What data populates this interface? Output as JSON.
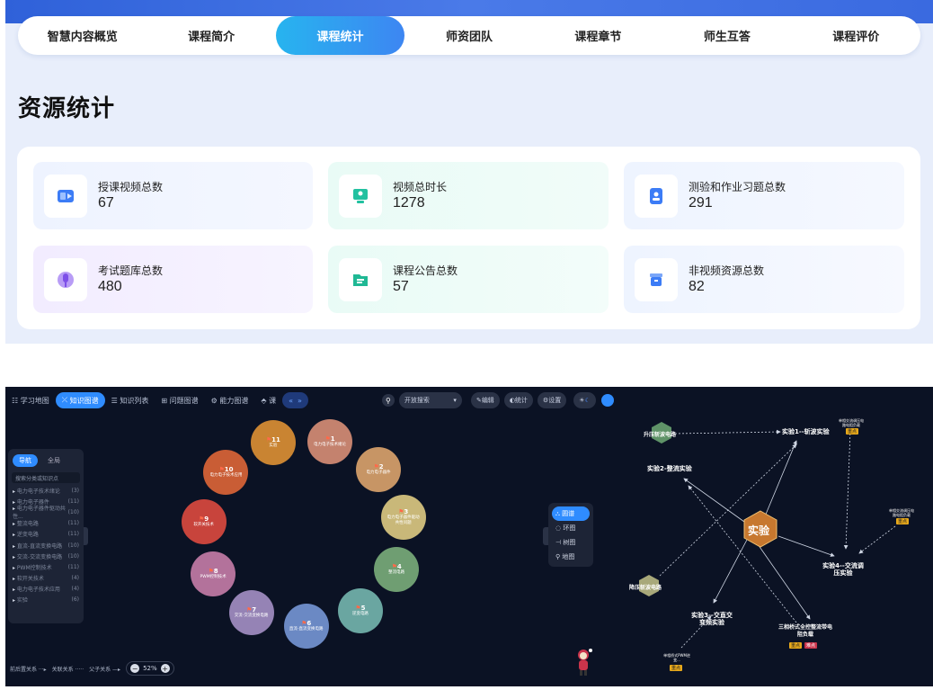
{
  "tabs": [
    "智慧内容概览",
    "课程简介",
    "课程统计",
    "师资团队",
    "课程章节",
    "师生互答",
    "课程评价"
  ],
  "active_tab": "课程统计",
  "section_title": "资源统计",
  "stats": [
    {
      "label": "授课视频总数",
      "value": "67",
      "icon": "video-icon",
      "color": "#3c7cf6"
    },
    {
      "label": "视频总时长",
      "value": "1278",
      "icon": "monitor-icon",
      "color": "#22c1a0"
    },
    {
      "label": "测验和作业习题总数",
      "value": "291",
      "icon": "quiz-icon",
      "color": "#3c7cf6"
    },
    {
      "label": "考试题库总数",
      "value": "480",
      "icon": "microphone-icon",
      "color": "#9b6cf0"
    },
    {
      "label": "课程公告总数",
      "value": "57",
      "icon": "folder-icon",
      "color": "#1fb894"
    },
    {
      "label": "非视频资源总数",
      "value": "82",
      "icon": "box-icon",
      "color": "#3c7cf6"
    }
  ],
  "kg_toolbar": {
    "items": [
      "学习地图",
      "知识图谱",
      "知识列表",
      "问题图谱",
      "能力图谱",
      "课"
    ],
    "active": "知识图谱",
    "dropdown": "开放搜索",
    "actions": [
      "编辑",
      "统计",
      "设置"
    ]
  },
  "sidebar": {
    "tabs": [
      "导航",
      "全局"
    ],
    "search_placeholder": "搜索分类或知识点",
    "items": [
      {
        "label": "电力电子技术绪论",
        "count": "(3)"
      },
      {
        "label": "电力电子器件",
        "count": "(11)"
      },
      {
        "label": "电力电子器件驱动共性...",
        "count": "(10)"
      },
      {
        "label": "整流电路",
        "count": "(11)"
      },
      {
        "label": "逆变电路",
        "count": "(11)"
      },
      {
        "label": "直流-直流变换电路",
        "count": "(10)"
      },
      {
        "label": "交流-交流变换电路",
        "count": "(10)"
      },
      {
        "label": "PWM控制技术",
        "count": "(11)"
      },
      {
        "label": "软开关技术",
        "count": "(4)"
      },
      {
        "label": "电力电子技术应用",
        "count": "(4)"
      },
      {
        "label": "实验",
        "count": "(6)"
      }
    ]
  },
  "view_modes": [
    "圆谱",
    "环图",
    "树图",
    "地图"
  ],
  "active_mode": "圆谱",
  "legend": [
    "前后置关系",
    "关联关系",
    "父子关系"
  ],
  "zoom": "52%",
  "ring_nodes": [
    {
      "n": "1",
      "t": "电力电子技术绪论",
      "color": "#c4826e"
    },
    {
      "n": "2",
      "t": "电力电子器件",
      "color": "#c79565"
    },
    {
      "n": "3",
      "t": "电力电子器件驱动共性问题",
      "color": "#c9b879"
    },
    {
      "n": "4",
      "t": "整流电路",
      "color": "#6f9e72"
    },
    {
      "n": "5",
      "t": "逆变电路",
      "color": "#6aa6a1"
    },
    {
      "n": "6",
      "t": "直流-直流变换电路",
      "color": "#6b89c4"
    },
    {
      "n": "7",
      "t": "交流-交流变换电路",
      "color": "#9583b5"
    },
    {
      "n": "8",
      "t": "PWM控制技术",
      "color": "#b3729b"
    },
    {
      "n": "9",
      "t": "软开关技术",
      "color": "#c8443c"
    },
    {
      "n": "10",
      "t": "电力电子技术应用",
      "color": "#c95d35"
    },
    {
      "n": "11",
      "t": "实验",
      "color": "#c98432"
    }
  ],
  "graph": {
    "center": "实验",
    "nodes": {
      "sj1": "实验1--斩波实验",
      "sj2": "实验2-整流实验",
      "sj3": "实验3--交直交变频实验",
      "sj4": "实验4--交流调压实验",
      "sy": "升压斩波电路",
      "jy": "降压斩波电路",
      "sxq": "三相桥式全控整流带电阻负载",
      "small1": "单相交流调压电路电阻负载",
      "small2": "单相交流调压电路电阻负载",
      "small3": "单相桥式PWM逆变..."
    },
    "tags": {
      "key": "重点",
      "hard": "难点"
    }
  }
}
